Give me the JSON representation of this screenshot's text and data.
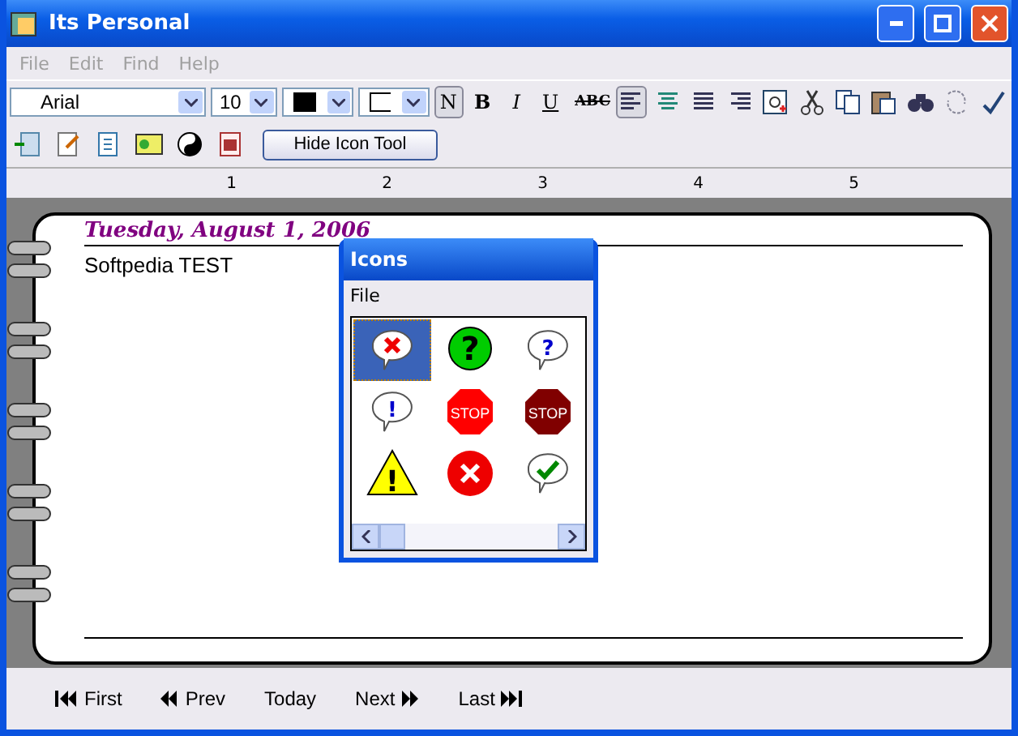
{
  "window": {
    "title": "Its Personal"
  },
  "menu": [
    {
      "label": "File",
      "disabled": true
    },
    {
      "label": "Edit",
      "disabled": true
    },
    {
      "label": "Find",
      "disabled": true
    },
    {
      "label": "Help",
      "disabled": true
    }
  ],
  "format_bar": {
    "font": "Arial",
    "size": "10",
    "styles": [
      {
        "label": "N",
        "selected": true,
        "kind": "normal"
      },
      {
        "label": "B",
        "selected": false,
        "kind": "bold"
      },
      {
        "label": "I",
        "selected": false,
        "kind": "italic"
      },
      {
        "label": "U",
        "selected": false,
        "kind": "underline"
      },
      {
        "label": "ABC",
        "selected": false,
        "kind": "strike"
      }
    ],
    "align": [
      {
        "kind": "left",
        "selected": true
      },
      {
        "kind": "center",
        "selected": false
      },
      {
        "kind": "justify",
        "selected": false
      },
      {
        "kind": "right",
        "selected": false
      }
    ]
  },
  "icon_bar": {
    "button": "Hide Icon Tool"
  },
  "ruler": {
    "marks": [
      "1",
      "2",
      "3",
      "4",
      "5"
    ]
  },
  "page": {
    "date": "Tuesday, August 1, 2006",
    "text": "Softpedia TEST"
  },
  "icons_window": {
    "title": "Icons",
    "menu": "File",
    "icons": [
      {
        "kind": "bubble-x",
        "selected": true
      },
      {
        "kind": "green-question",
        "selected": false,
        "glyph": "?"
      },
      {
        "kind": "bubble-question",
        "selected": false,
        "glyph": "?"
      },
      {
        "kind": "bubble-exclaim",
        "selected": false,
        "glyph": "!"
      },
      {
        "kind": "stop",
        "selected": false,
        "label": "STOP",
        "color": "#ff0000"
      },
      {
        "kind": "stop",
        "selected": false,
        "label": "STOP",
        "color": "#800000"
      },
      {
        "kind": "warning",
        "selected": false,
        "glyph": "!"
      },
      {
        "kind": "red-x",
        "selected": false
      },
      {
        "kind": "bubble-check",
        "selected": false
      }
    ]
  },
  "nav": [
    {
      "label": "First",
      "kind": "first"
    },
    {
      "label": "Prev",
      "kind": "prev"
    },
    {
      "label": "Today",
      "kind": "today"
    },
    {
      "label": "Next",
      "kind": "next"
    },
    {
      "label": "Last",
      "kind": "last"
    }
  ]
}
